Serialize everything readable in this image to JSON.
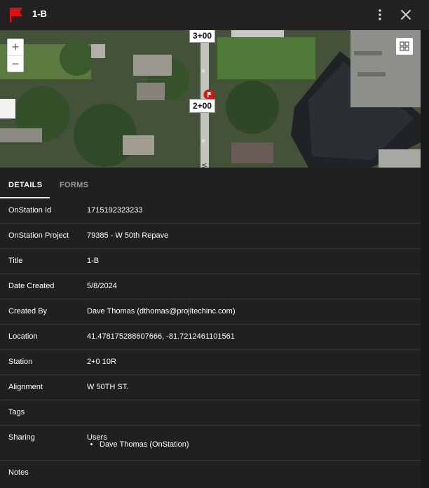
{
  "header": {
    "title": "1-B",
    "flag_color": "#e01010"
  },
  "map": {
    "station_top": "3+00",
    "station_mid": "2+00",
    "road_label": "W 5",
    "zoom_in": "+",
    "zoom_out": "−"
  },
  "tabs": {
    "details": "DETAILS",
    "forms": "FORMS"
  },
  "details": {
    "onstation_id": {
      "label": "OnStation Id",
      "value": "1715192323233"
    },
    "onstation_project": {
      "label": "OnStation Project",
      "value": "79385 - W 50th Repave"
    },
    "title": {
      "label": "Title",
      "value": "1-B"
    },
    "date_created": {
      "label": "Date Created",
      "value": "5/8/2024"
    },
    "created_by": {
      "label": "Created By",
      "value": "Dave Thomas (dthomas@projitechinc.com)"
    },
    "location": {
      "label": "Location",
      "value": "41.478175288607666, -81.7212461101561"
    },
    "station": {
      "label": "Station",
      "value": "2+0 10R"
    },
    "alignment": {
      "label": "Alignment",
      "value": "W 50TH ST."
    },
    "tags": {
      "label": "Tags",
      "value": ""
    },
    "sharing": {
      "label": "Sharing",
      "value": "Users",
      "users": [
        "Dave Thomas (OnStation)"
      ]
    },
    "notes": {
      "label": "Notes",
      "value": ""
    }
  }
}
